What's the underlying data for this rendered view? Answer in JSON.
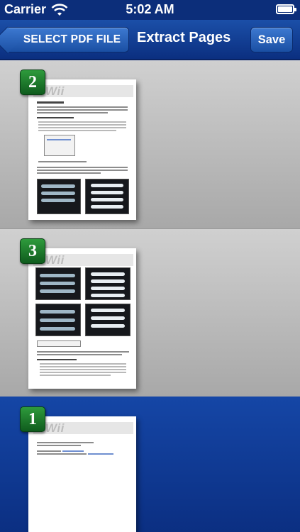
{
  "status_bar": {
    "carrier": "Carrier",
    "time": "5:02 AM",
    "battery_level": 1.0
  },
  "nav": {
    "back_label": "SELECT PDF FILE",
    "title": "Extract Pages",
    "save_label": "Save"
  },
  "pages": [
    {
      "number": "2",
      "logo_text": "Wii",
      "selected": false
    },
    {
      "number": "3",
      "logo_text": "Wii",
      "selected": false
    },
    {
      "number": "1",
      "logo_text": "Wii",
      "selected": true
    }
  ],
  "colors": {
    "nav": "#1b4fa8",
    "row_gray": "#c0c0c0",
    "row_selected": "#1546a6",
    "badge": "#1f7a2d"
  },
  "icons": [
    "wifi-icon",
    "battery-icon",
    "back-arrow-icon"
  ]
}
